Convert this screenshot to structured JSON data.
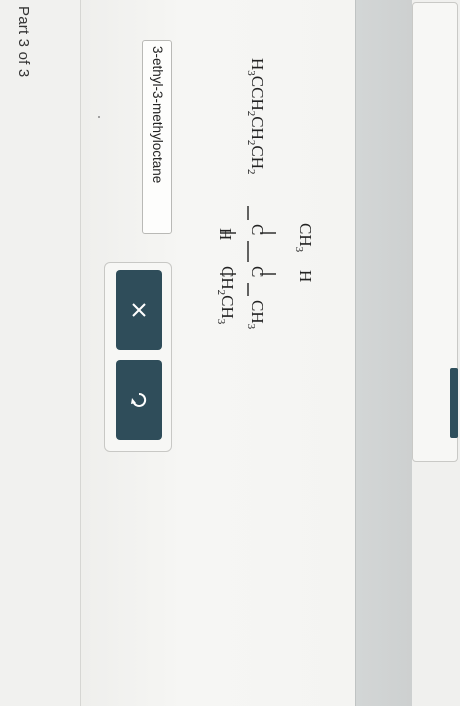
{
  "header": {
    "part_label": "Part 3 of 3"
  },
  "answer": {
    "value": "3-ethyl-3-methyloctane"
  },
  "structure": {
    "chain": "H3CCH2CH2CH2",
    "top_c1_sub": "CH3",
    "top_c2_sub": "H",
    "bottom_c1_sub": "H",
    "bottom_c2_sub": "CH2CH3",
    "end_group": "CH3"
  },
  "actions": {
    "clear_icon": "x-icon",
    "undo_icon": "undo-icon"
  },
  "colors": {
    "button": "#2f4d5a",
    "band": "#d0d3d3"
  }
}
